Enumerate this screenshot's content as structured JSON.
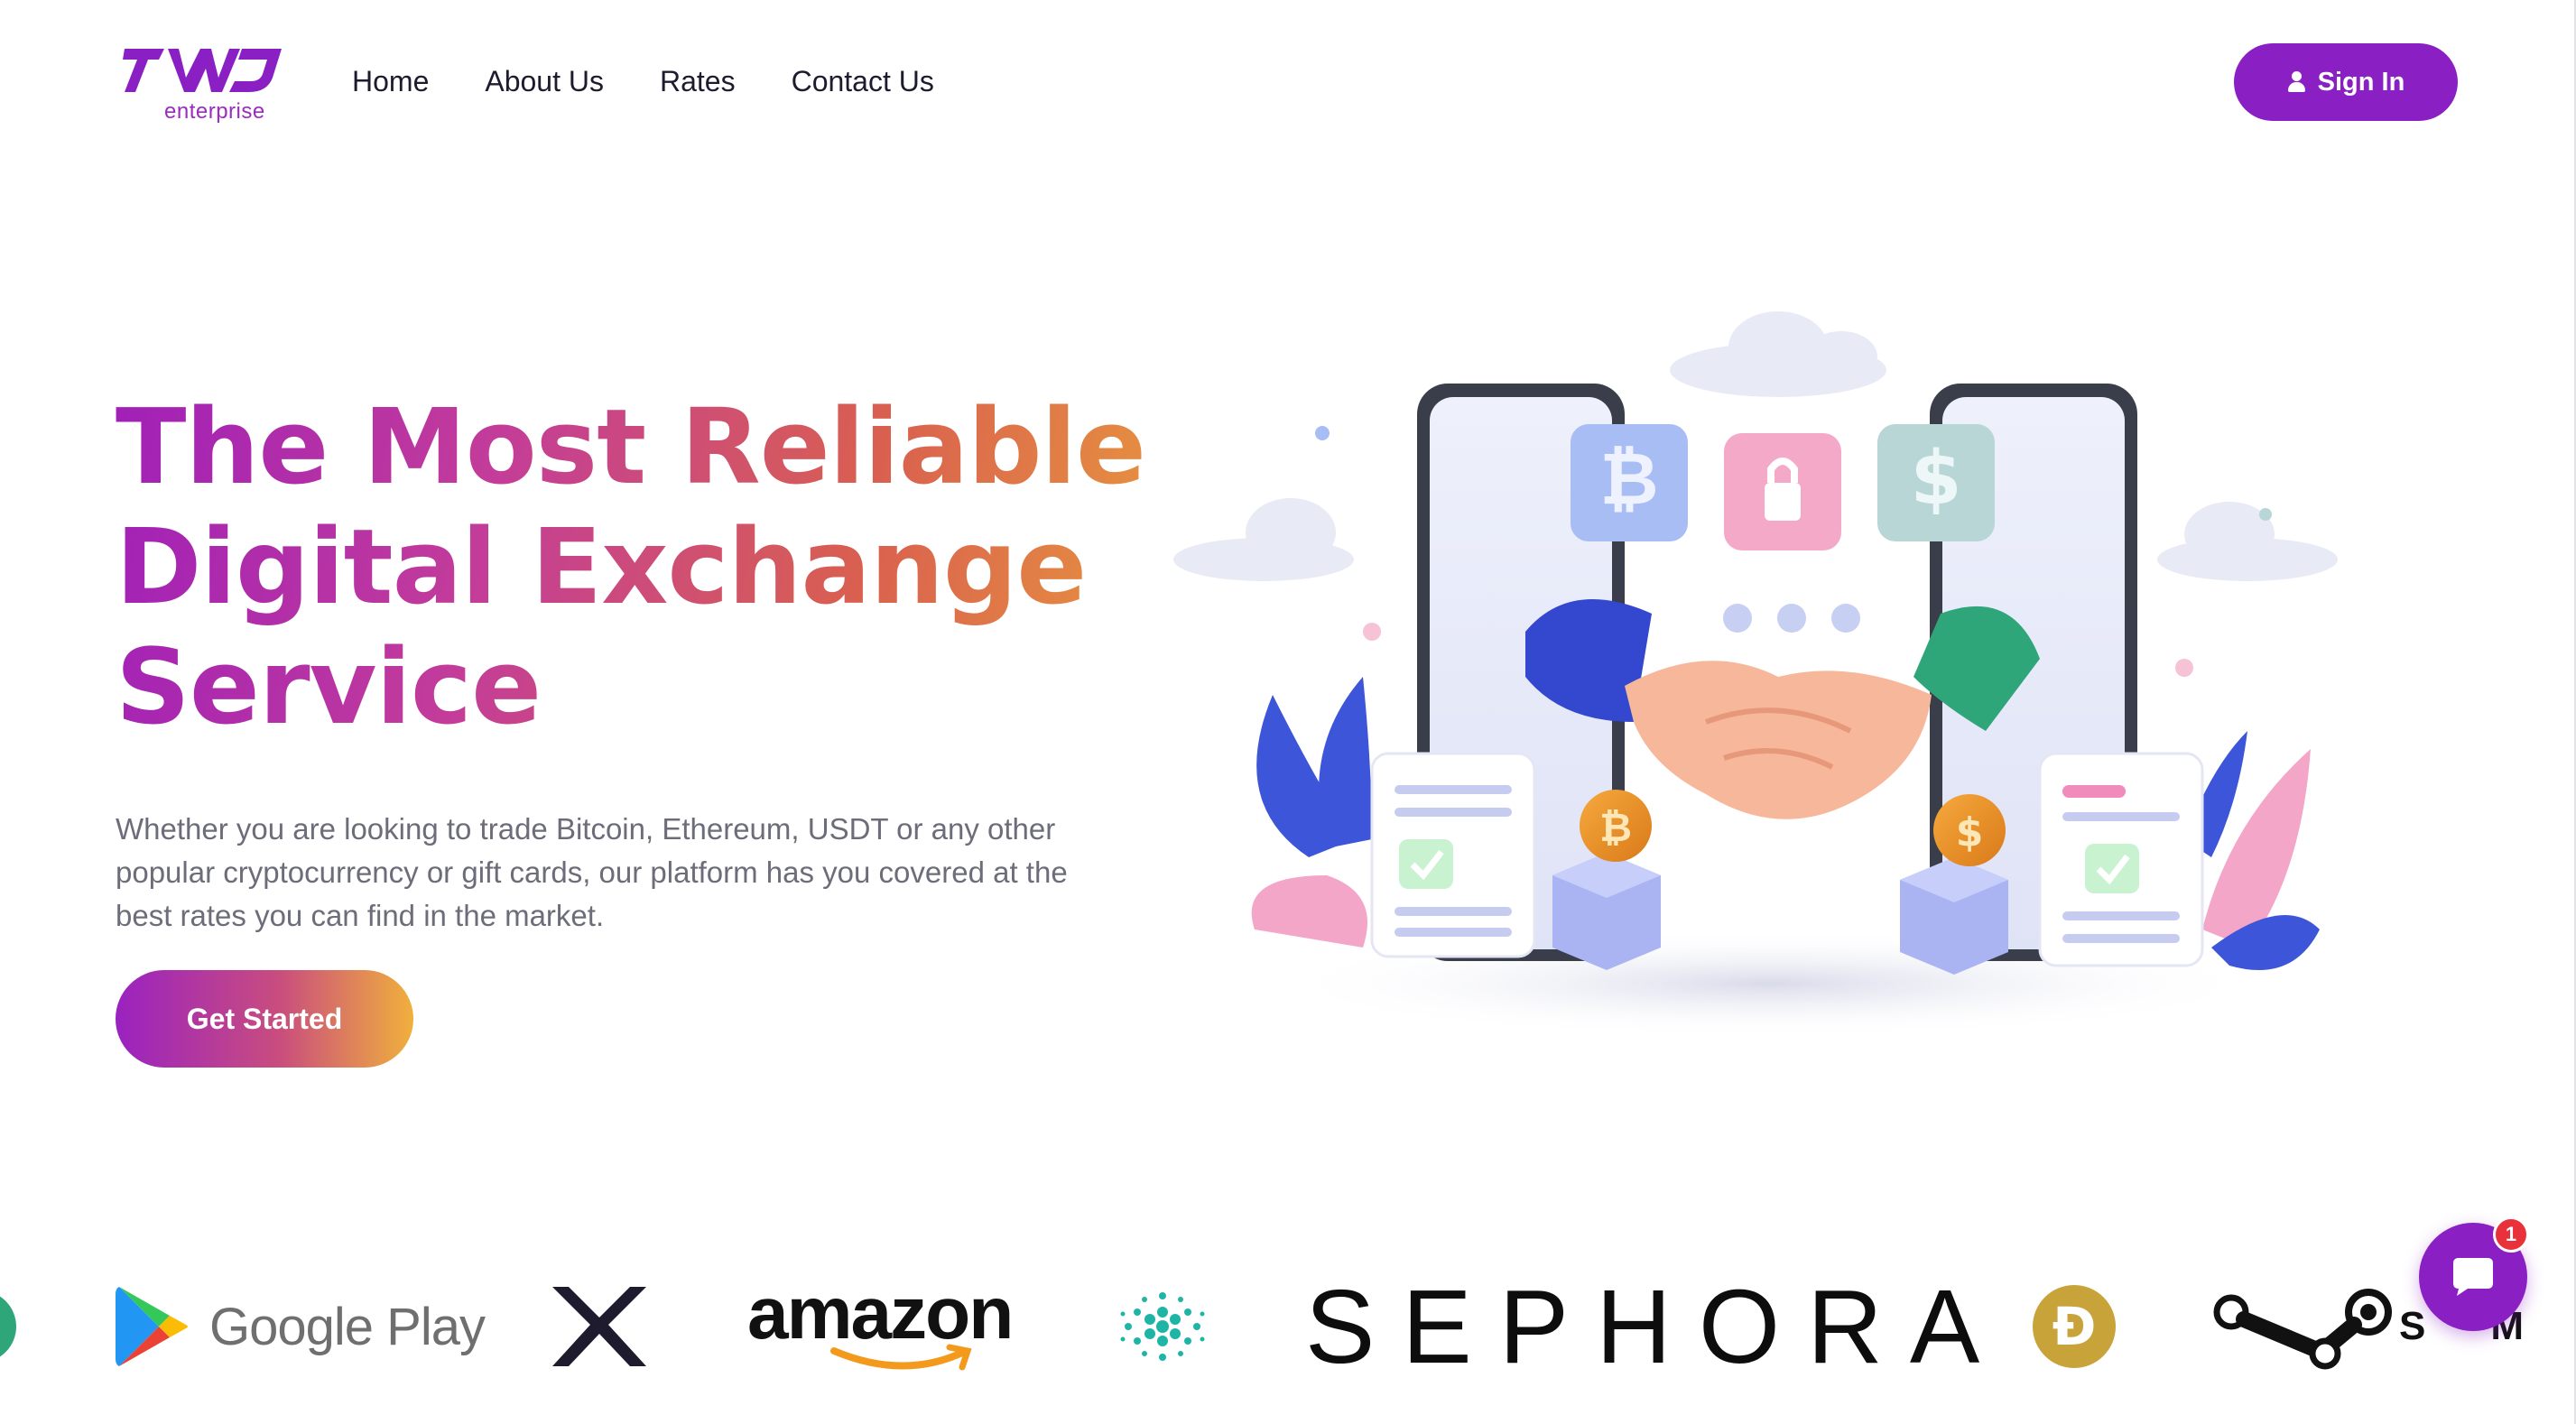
{
  "brand": {
    "logo_subtitle": "enterprise",
    "accent_color": "#8a1fc4"
  },
  "nav": {
    "items": [
      "Home",
      "About Us",
      "Rates",
      "Contact Us"
    ],
    "signin_label": "Sign In",
    "signin_icon": "user-icon"
  },
  "hero": {
    "title_lines": [
      "The Most Reliable",
      "Digital Exchange",
      "Service"
    ],
    "description": "Whether you are looking to trade Bitcoin, Ethereum, USDT or any other popular cryptocurrency or gift cards, our platform has you covered at the best rates you can find in the market.",
    "cta_label": "Get Started"
  },
  "partners": {
    "google_play": "Google Play",
    "amazon": "amazon",
    "sephora": "SEPHORA",
    "steam_partial": "S",
    "steam_tail": "M",
    "items": [
      "google-play-logo",
      "xrp-logo",
      "amazon-logo",
      "cardano-logo",
      "sephora-logo",
      "dogecoin-logo",
      "steam-logo"
    ]
  },
  "chat": {
    "badge_count": "1",
    "icon": "chat-bubble-icon"
  }
}
